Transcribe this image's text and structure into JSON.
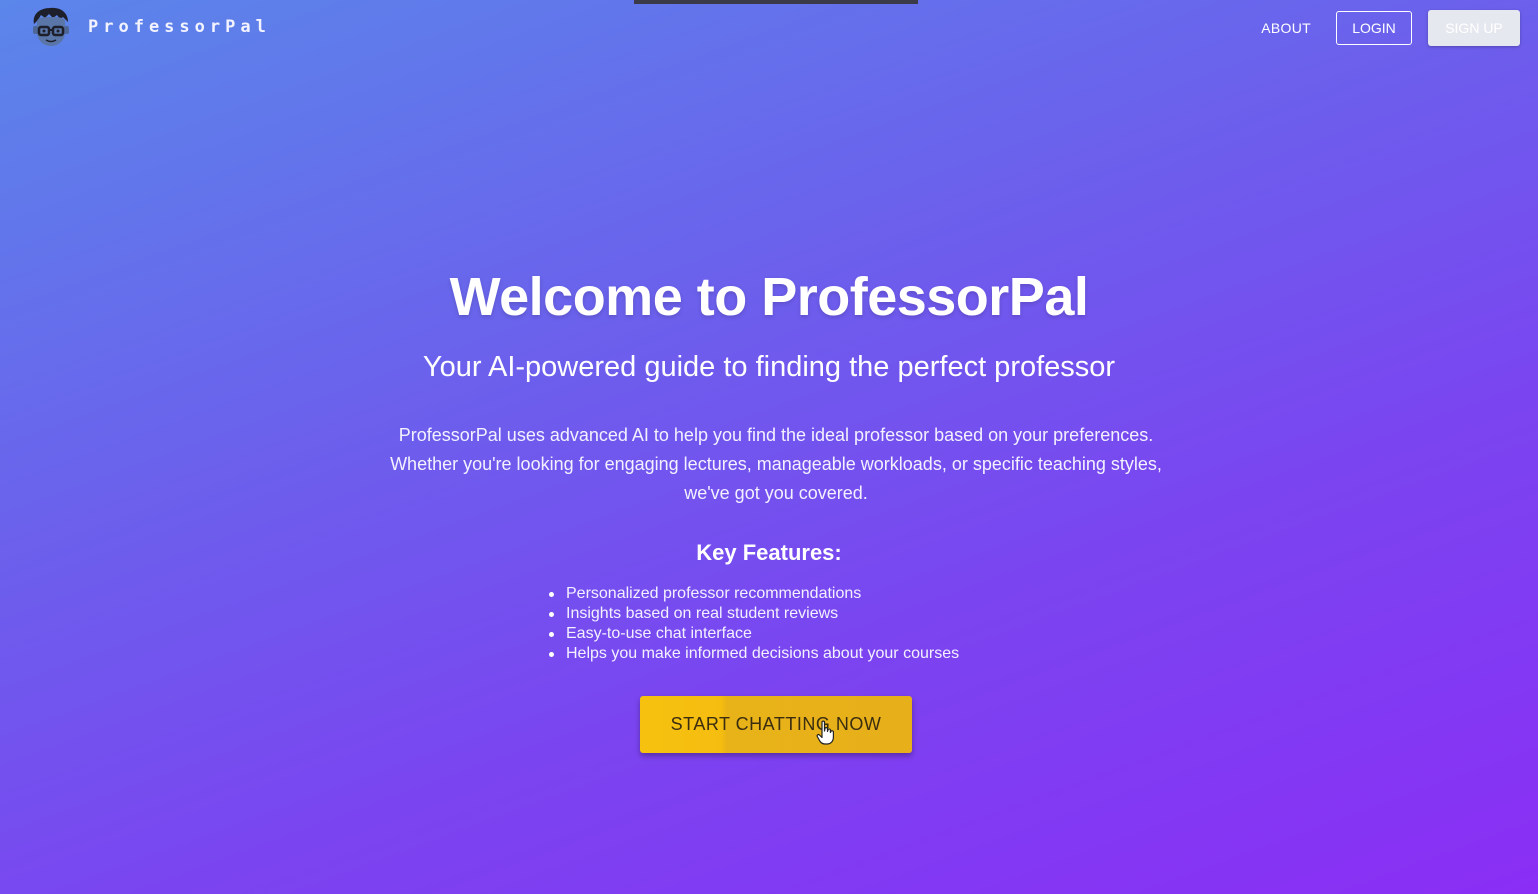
{
  "header": {
    "brand_name": "ProfessorPal",
    "nav": {
      "about": "ABOUT",
      "login": "LOGIN",
      "signup": "SIGN UP"
    }
  },
  "hero": {
    "title": "Welcome to ProfessorPal",
    "subtitle": "Your AI-powered guide to finding the perfect professor",
    "description_lines": [
      "ProfessorPal uses advanced AI to help you find the ideal professor based on your preferences.",
      "Whether you're looking for engaging lectures, manageable workloads, or specific teaching styles,",
      "we've got you covered."
    ]
  },
  "features": {
    "title": "Key Features:",
    "items": [
      "Personalized professor recommendations",
      "Insights based on real student reviews",
      "Easy-to-use chat interface",
      "Helps you make informed decisions about your courses"
    ]
  },
  "cta": {
    "label": "START CHATTING NOW"
  },
  "colors": {
    "gradient_start": "#5b86ea",
    "gradient_end": "#8a2ef5",
    "cta": "#f5bd10"
  },
  "icons": {
    "brand_logo": "professor-face-icon",
    "cursor": "hand-pointer-icon"
  }
}
